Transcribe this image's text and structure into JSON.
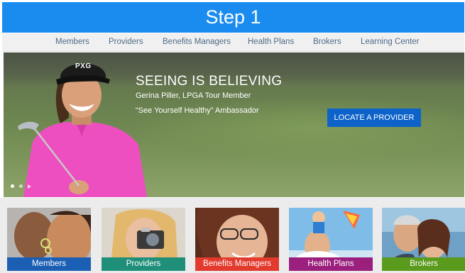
{
  "step": {
    "title": "Step 1"
  },
  "nav": {
    "items": [
      "Members",
      "Providers",
      "Benefits Managers",
      "Health Plans",
      "Brokers",
      "Learning Center"
    ]
  },
  "hero": {
    "title": "SEEING IS BELIEVING",
    "subtitle": "Gerina Piller, LPGA Tour Member",
    "tagline": "“See Yourself Healthy” Ambassador",
    "cta_label": "LOCATE A PROVIDER",
    "cap_logo": "PXG"
  },
  "cards": [
    {
      "label": "Members",
      "color": "#1a5fb4"
    },
    {
      "label": "Providers",
      "color": "#1f8f7a"
    },
    {
      "label": "Benefits Managers",
      "color": "#e23a2d"
    },
    {
      "label": "Health Plans",
      "color": "#9b1f7c"
    },
    {
      "label": "Brokers",
      "color": "#5a9a1c"
    }
  ],
  "colors": {
    "step_banner": "#1a8cf0",
    "cta": "#0d63c9",
    "shirt": "#ee4fc0"
  }
}
